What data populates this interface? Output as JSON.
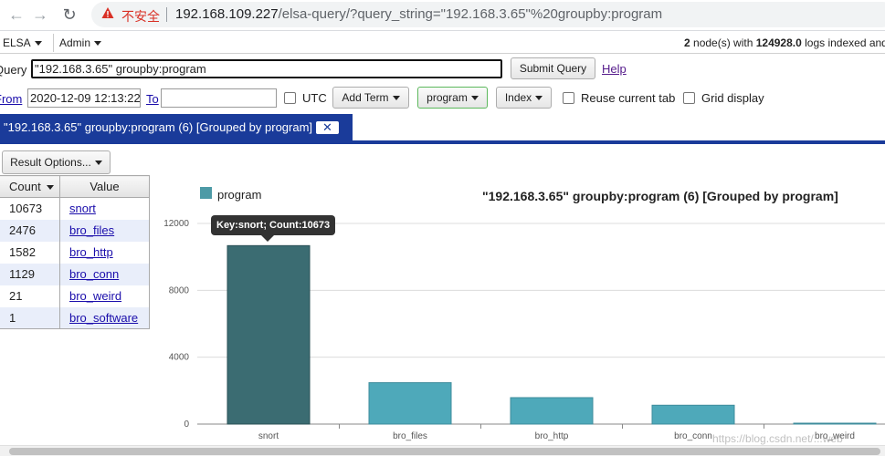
{
  "browser": {
    "insecure_label": "不安全",
    "url_host": "192.168.109.227",
    "url_path": "/elsa-query/?query_string=\"192.168.3.65\"%20groupby:program"
  },
  "menubar": {
    "elsa_label": "ELSA",
    "admin_label": "Admin",
    "node_count": "2",
    "node_text_1": " node(s) with ",
    "log_count": "124928.0",
    "node_text_2": " logs indexed and"
  },
  "query": {
    "label": "Query",
    "value": "\"192.168.3.65\" groupby:program",
    "submit_label": "Submit Query",
    "help_label": "Help"
  },
  "time": {
    "from_label": "From",
    "from_value": "2020-12-09 12:13:22",
    "to_label": "To",
    "to_value": "",
    "utc_label": "UTC"
  },
  "toolbar": {
    "add_term_label": "Add Term",
    "program_label": "program",
    "index_label": "Index",
    "reuse_label": "Reuse current tab",
    "grid_label": "Grid display"
  },
  "tab": {
    "label": "\"192.168.3.65\" groupby:program (6) [Grouped by program]",
    "close_label": "✕"
  },
  "results": {
    "options_label": "Result Options...",
    "count_header": "Count",
    "value_header": "Value",
    "rows": [
      {
        "count": "10673",
        "value": "snort"
      },
      {
        "count": "2476",
        "value": "bro_files"
      },
      {
        "count": "1582",
        "value": "bro_http"
      },
      {
        "count": "1129",
        "value": "bro_conn"
      },
      {
        "count": "21",
        "value": "bro_weird"
      },
      {
        "count": "1",
        "value": "bro_software"
      }
    ]
  },
  "tooltip": "Key:snort; Count:10673",
  "watermark": "https://blog.csdn.net/...web",
  "chart_data": {
    "type": "bar",
    "title": "\"192.168.3.65\" groupby:program (6) [Grouped by program]",
    "legend": "program",
    "legend_position": "top-left",
    "categories": [
      "snort",
      "bro_files",
      "bro_http",
      "bro_conn",
      "bro_weird"
    ],
    "series": [
      {
        "name": "program",
        "values": [
          10673,
          2476,
          1582,
          1129,
          21
        ]
      }
    ],
    "yticks": [
      0,
      4000,
      8000,
      12000
    ],
    "ylim": [
      0,
      12000
    ],
    "grid": true,
    "bar_color": "#4ea9ba",
    "highlight_color": "#3b6c72"
  }
}
